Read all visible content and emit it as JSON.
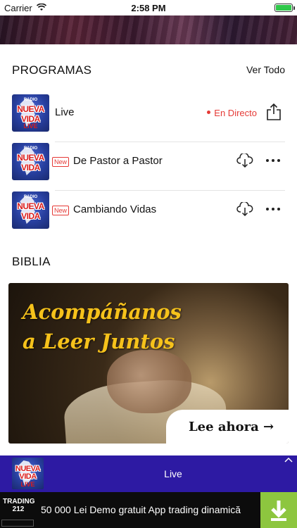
{
  "status_bar": {
    "carrier": "Carrier",
    "time": "2:58 PM",
    "battery_level": 1.0
  },
  "programs": {
    "title": "PROGRAMAS",
    "see_all": "Ver Todo",
    "items": [
      {
        "title": "Live",
        "badge": "",
        "status": "En Directo",
        "logo_radio": "RADIO",
        "logo_line1": "NUEVA",
        "logo_line2": "VIDA",
        "logo_tag": "LIVE"
      },
      {
        "title": "De Pastor a Pastor",
        "badge": "New",
        "logo_radio": "RADIO",
        "logo_line1": "NUEVA",
        "logo_line2": "VIDA"
      },
      {
        "title": "Cambiando Vidas",
        "badge": "New",
        "logo_radio": "RADIO",
        "logo_line1": "NUEVA",
        "logo_line2": "VIDA"
      }
    ]
  },
  "bible": {
    "title": "BIBLIA",
    "headline_line1": "Acompáñanos",
    "headline_line2": "a Leer Juntos",
    "cta": "Lee ahora →"
  },
  "player": {
    "title": "Live",
    "logo_line1": "NUEVA",
    "logo_line2": "VIDA",
    "logo_tag": "LIVE"
  },
  "ad": {
    "logo_line1": "TRADING",
    "logo_line2": "212",
    "text": "50 000 Lei Demo gratuit App trading dinamică"
  },
  "colors": {
    "accent_red": "#e53935",
    "player_bg": "#2d1aa3",
    "headline_yellow": "#f6c21b",
    "download_green": "#8dc63f"
  }
}
